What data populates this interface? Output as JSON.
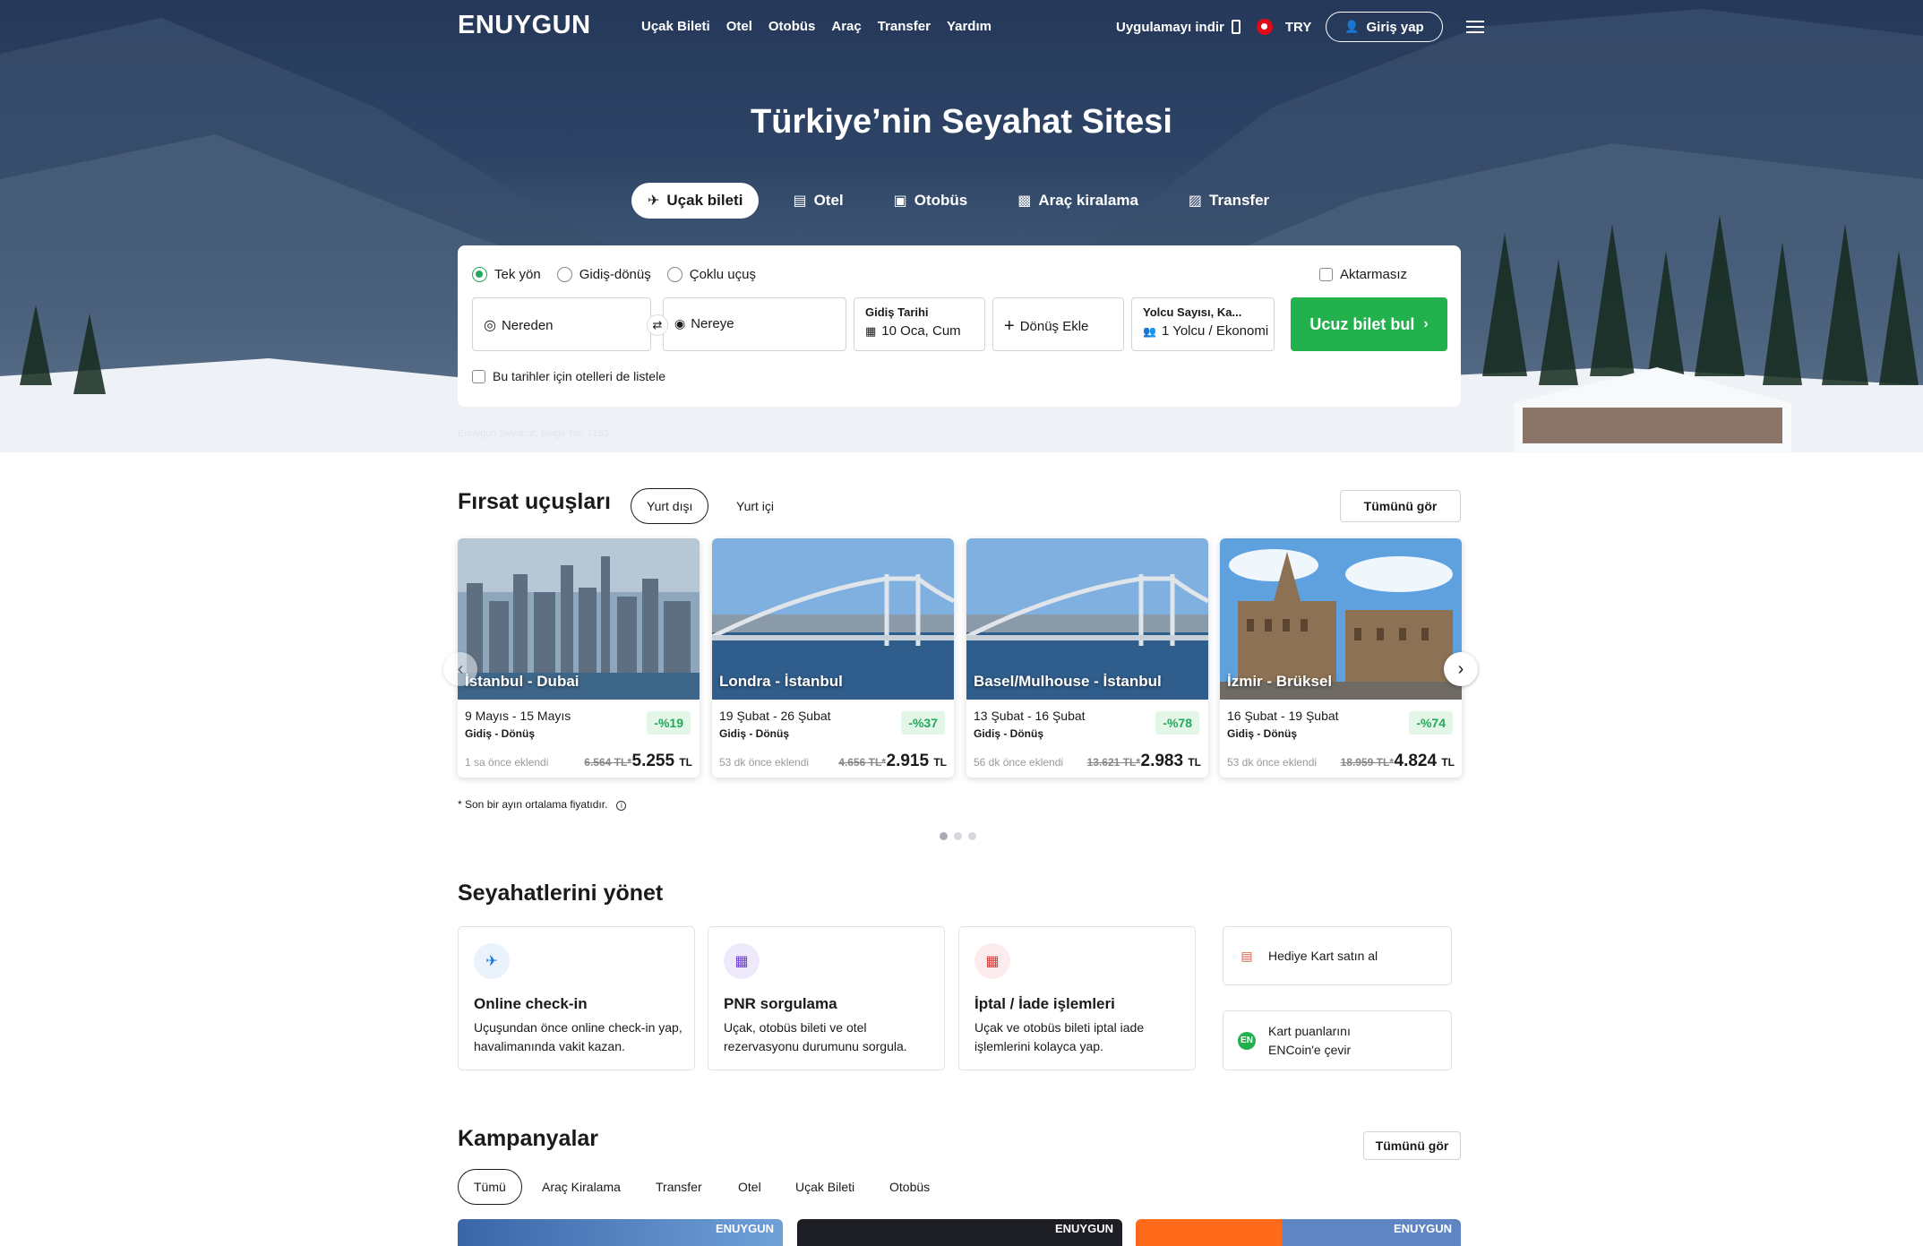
{
  "header": {
    "logo": "ENUYGUN",
    "nav": [
      "Uçak Bileti",
      "Otel",
      "Otobüs",
      "Araç",
      "Transfer",
      "Yardım"
    ],
    "app_download": "Uygulamayı indir",
    "currency": "TRY",
    "login": "Giriş yap"
  },
  "hero": {
    "title": "Türkiye’nin Seyahat Sitesi",
    "tabs": [
      "Uçak bileti",
      "Otel",
      "Otobüs",
      "Araç kiralama",
      "Transfer"
    ],
    "licence": "Enuygun Seyahat, Belge No: 7153"
  },
  "search": {
    "trip_types": [
      "Tek yön",
      "Gidiş-dönüş",
      "Çoklu uçuş"
    ],
    "selected_trip_type": "Tek yön",
    "direct_only": "Aktarmasız",
    "from_placeholder": "Nereden",
    "to_placeholder": "Nereye",
    "depart_label": "Gidiş Tarihi",
    "depart_value": "10 Oca, Cum",
    "return_add": "Dönüş Ekle",
    "passenger_label": "Yolcu Sayısı, Ka...",
    "passenger_value": "1 Yolcu / Ekonomi",
    "submit": "Ucuz bilet bul",
    "list_hotels": "Bu tarihler için otelleri de listele"
  },
  "deals": {
    "title": "Fırsat uçuşları",
    "tabs": [
      "Yurt dışı",
      "Yurt içi"
    ],
    "see_all": "Tümünü gör",
    "cards": [
      {
        "route": "İstanbul - Dubai",
        "dates": "9 Mayıs - 15 Mayıs",
        "type": "Gidiş - Dönüş",
        "discount": "-%19",
        "added": "1 sa önce eklendi",
        "old_price": "6.564 TL*",
        "price": "5.255",
        "currency": "TL"
      },
      {
        "route": "Londra - İstanbul",
        "dates": "19 Şubat - 26 Şubat",
        "type": "Gidiş - Dönüş",
        "discount": "-%37",
        "added": "53 dk önce eklendi",
        "old_price": "4.656 TL*",
        "price": "2.915",
        "currency": "TL"
      },
      {
        "route": "Basel/Mulhouse - İstanbul",
        "dates": "13 Şubat - 16 Şubat",
        "type": "Gidiş - Dönüş",
        "discount": "-%78",
        "added": "56 dk önce eklendi",
        "old_price": "13.621 TL*",
        "price": "2.983",
        "currency": "TL"
      },
      {
        "route": "İzmir - Brüksel",
        "dates": "16 Şubat - 19 Şubat",
        "type": "Gidiş - Dönüş",
        "discount": "-%74",
        "added": "53 dk önce eklendi",
        "old_price": "18.959 TL*",
        "price": "4.824",
        "currency": "TL"
      }
    ],
    "footnote": "* Son bir ayın ortalama fiyatıdır.",
    "carousel_pages": 3,
    "carousel_active": 1
  },
  "manage": {
    "title": "Seyahatlerini yönet",
    "cards": [
      {
        "title": "Online check-in",
        "desc": "Uçuşundan önce online check-in yap, havalimanında vakit kazan."
      },
      {
        "title": "PNR sorgulama",
        "desc": "Uçak, otobüs bileti ve otel rezervasyonu durumunu sorgula."
      },
      {
        "title": "İptal / İade işlemleri",
        "desc": "Uçak ve otobüs bileti iptal iade işlemlerini kolayca yap."
      }
    ],
    "side": [
      "Hediye Kart satın al",
      "Kart puanlarını ENCoin'e çevir"
    ],
    "encoin_badge": "EN"
  },
  "campaigns": {
    "title": "Kampanyalar",
    "see_all": "Tümünü gör",
    "tabs": [
      "Tümü",
      "Araç Kiralama",
      "Transfer",
      "Otel",
      "Uçak Bileti",
      "Otobüs"
    ],
    "banner_logo": "ENUYGUN"
  },
  "colors": {
    "accent": "#22b14c",
    "discount_bg": "#e3f6e8",
    "hero_sky": "#2e4466"
  }
}
